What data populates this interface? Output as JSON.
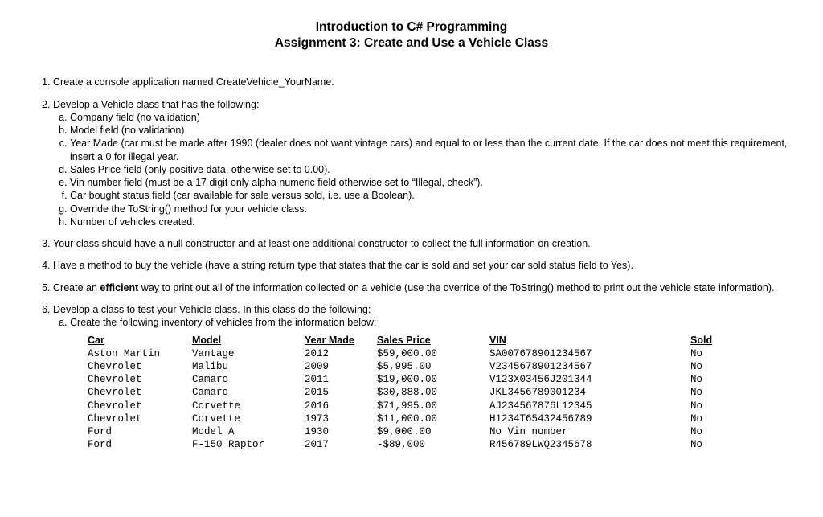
{
  "header": {
    "title": "Introduction to C# Programming",
    "subtitle": "Assignment 3: Create and Use a Vehicle Class"
  },
  "items": {
    "i1": "Create a console application named CreateVehicle_YourName.",
    "i2": "Develop a Vehicle class that has the following:",
    "i2a": "Company field (no validation)",
    "i2b": "Model field (no validation)",
    "i2c": "Year Made (car must be made after 1990 (dealer does not want vintage cars) and equal to or less than the current date. If the car does not meet this requirement, insert a 0 for illegal year.",
    "i2d": "Sales Price field (only positive data, otherwise set to 0.00).",
    "i2e": "Vin number field (must be a 17 digit only alpha numeric field otherwise set to “Illegal, check”).",
    "i2f": "Car bought status field (car available for sale versus sold, i.e. use a Boolean).",
    "i2g": "Override the ToString() method for your vehicle class.",
    "i2h": "Number of vehicles created.",
    "i3": "Your class should have a null constructor and at least one additional constructor to collect the full information on creation.",
    "i4": "Have a method to buy the vehicle (have a string return type that states that the car is sold and set your car sold status field to Yes).",
    "i5a": "Create an ",
    "i5b": "efficient",
    "i5c": " way to print out all of the information collected on a vehicle (use the override of the ToString() method to print out the vehicle state information).",
    "i6": "Develop a class to test your Vehicle class. In this class do the following:",
    "i6a": "Create the following inventory of vehicles from the information below:"
  },
  "table": {
    "headers": {
      "car": "Car",
      "model": "Model",
      "year": "Year Made",
      "price": "Sales Price",
      "vin": "VIN",
      "sold": "Sold"
    },
    "rows": [
      {
        "car": "Aston Martin",
        "model": "Vantage",
        "year": "2012",
        "price": "$59,000.00",
        "vin": "SA007678901234567",
        "sold": "No"
      },
      {
        "car": "Chevrolet",
        "model": "Malibu",
        "year": "2009",
        "price": "$5,995.00",
        "vin": "V2345678901234567",
        "sold": "No"
      },
      {
        "car": "Chevrolet",
        "model": "Camaro",
        "year": "2011",
        "price": "$19,000.00",
        "vin": "V123X03456J201344",
        "sold": "No"
      },
      {
        "car": "Chevrolet",
        "model": "Camaro",
        "year": "2015",
        "price": "$30,888.00",
        "vin": "JKL3456789001234",
        "sold": "No"
      },
      {
        "car": "Chevrolet",
        "model": "Corvette",
        "year": "2016",
        "price": "$71,995.00",
        "vin": "AJ234567876L12345",
        "sold": "No"
      },
      {
        "car": "Chevrolet",
        "model": "Corvette",
        "year": "1973",
        "price": "$11,000.00",
        "vin": "H1234T65432456789",
        "sold": "No"
      },
      {
        "car": "Ford",
        "model": "Model A",
        "year": "1930",
        "price": "$9,000.00",
        "vin": "No Vin number",
        "sold": "No"
      },
      {
        "car": "Ford",
        "model": "F-150 Raptor",
        "year": "2017",
        "price": "-$89,000",
        "vin": "R456789LWQ2345678",
        "sold": "No"
      }
    ]
  }
}
